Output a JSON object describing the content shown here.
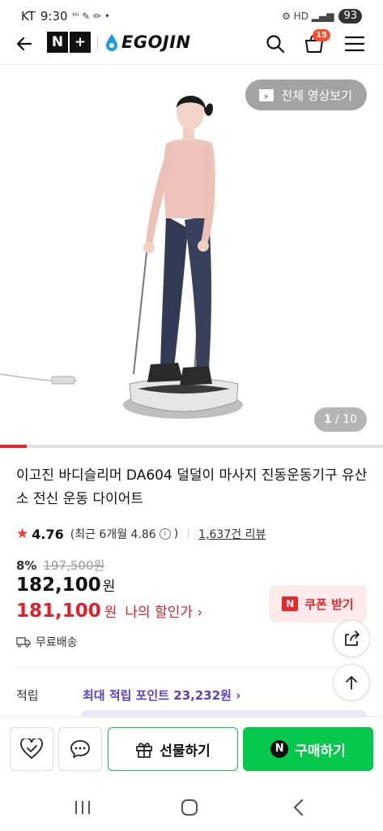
{
  "status_bar": {
    "carrier": "KT",
    "time": "9:30",
    "battery": "93"
  },
  "header": {
    "brand_badge_n": "N",
    "brand_badge_plus": "+",
    "brand_name": "EGOJIN",
    "cart_count": "15"
  },
  "media": {
    "video_button_label": "전체 영상보기",
    "current_index": "1",
    "total_label": " / 10",
    "progress_fraction": 0.07
  },
  "product": {
    "title": "이고진 바디슬리머 DA604 덜덜이 마사지 진동운동기구 유산소 전신 운동 다이어트",
    "rating": "4.76",
    "recent_rating": "(최근 6개월 4.86",
    "info_glyph": "i",
    "recent_close": ")",
    "review_count": "1,637건 리뷰",
    "discount_percent": "8%",
    "original_price": "197,500원",
    "price": "182,100",
    "price_unit": "원",
    "my_price": "181,100",
    "my_price_unit": "원",
    "my_price_link": "나의 할인가 ›",
    "coupon_label": "쿠폰 받기",
    "coupon_icon": "N",
    "shipping": "무료배송",
    "points_label": "적립",
    "points_value": "최대 적립 포인트 23,232원 ›"
  },
  "bottom_bar": {
    "gift_label": "선물하기",
    "buy_label": "구매하기",
    "buy_icon": "N"
  },
  "colors": {
    "accent_red": "#e8262c",
    "naver_green": "#06c84c",
    "points_purple": "#5a3fc9"
  }
}
